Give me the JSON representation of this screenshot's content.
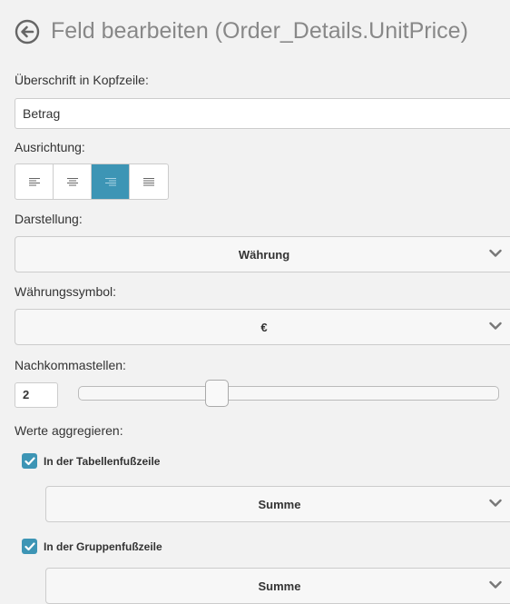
{
  "header": {
    "title": "Feld bearbeiten (Order_Details.UnitPrice)",
    "back_icon": "circle-arrow-left-icon"
  },
  "heading_field": {
    "label": "Überschrift in Kopfzeile:",
    "value": "Betrag"
  },
  "alignment": {
    "label": "Ausrichtung:",
    "options": [
      "align-left-icon",
      "align-center-icon",
      "align-right-icon",
      "align-justify-icon"
    ],
    "selected": "align-right-icon",
    "active_color": "#3d95b5"
  },
  "display": {
    "label": "Darstellung:",
    "value": "Währung"
  },
  "currency": {
    "label": "Währungssymbol:",
    "value": "€"
  },
  "decimals": {
    "label": "Nachkommastellen:",
    "value": "2"
  },
  "aggregate": {
    "label": "Werte aggregieren:",
    "table_footer": {
      "label": "In der Tabellenfußzeile",
      "checked": true,
      "function": "Summe"
    },
    "group_footer": {
      "label": "In der Gruppenfußzeile",
      "checked": true,
      "function": "Summe"
    }
  }
}
